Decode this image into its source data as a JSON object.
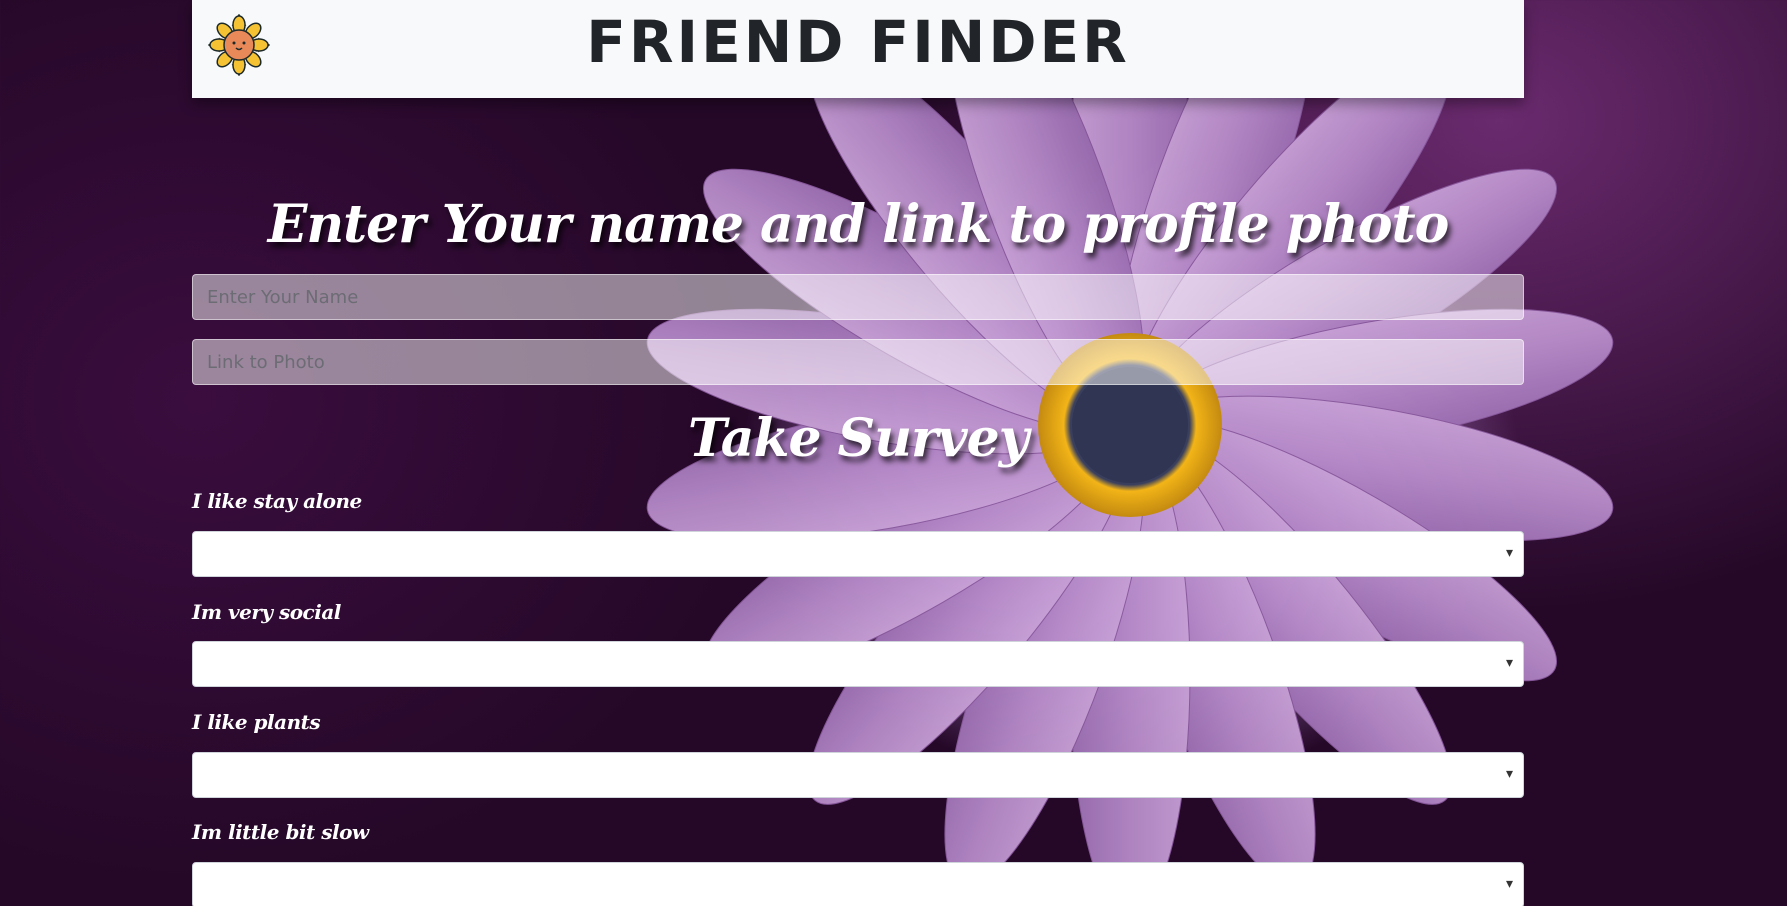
{
  "navbar": {
    "brand": "FRIEND FINDER",
    "logo_icon": "sunflower-face-icon"
  },
  "profile": {
    "heading": "Enter Your name and link to profile photo",
    "name_input": {
      "placeholder": "Enter Your Name",
      "value": ""
    },
    "photo_input": {
      "placeholder": "Link to Photo",
      "value": ""
    }
  },
  "survey": {
    "heading": "Take Survey",
    "questions": [
      {
        "label": "I like stay alone",
        "selected": ""
      },
      {
        "label": "Im very social",
        "selected": ""
      },
      {
        "label": "I like plants",
        "selected": ""
      },
      {
        "label": "Im little bit slow",
        "selected": ""
      }
    ]
  },
  "colors": {
    "navbar_bg": "#f8f9fa",
    "brand_text": "#212529",
    "background": "#2e0a32",
    "flower": "#b88fc9",
    "flower_center": "#f2b417"
  }
}
